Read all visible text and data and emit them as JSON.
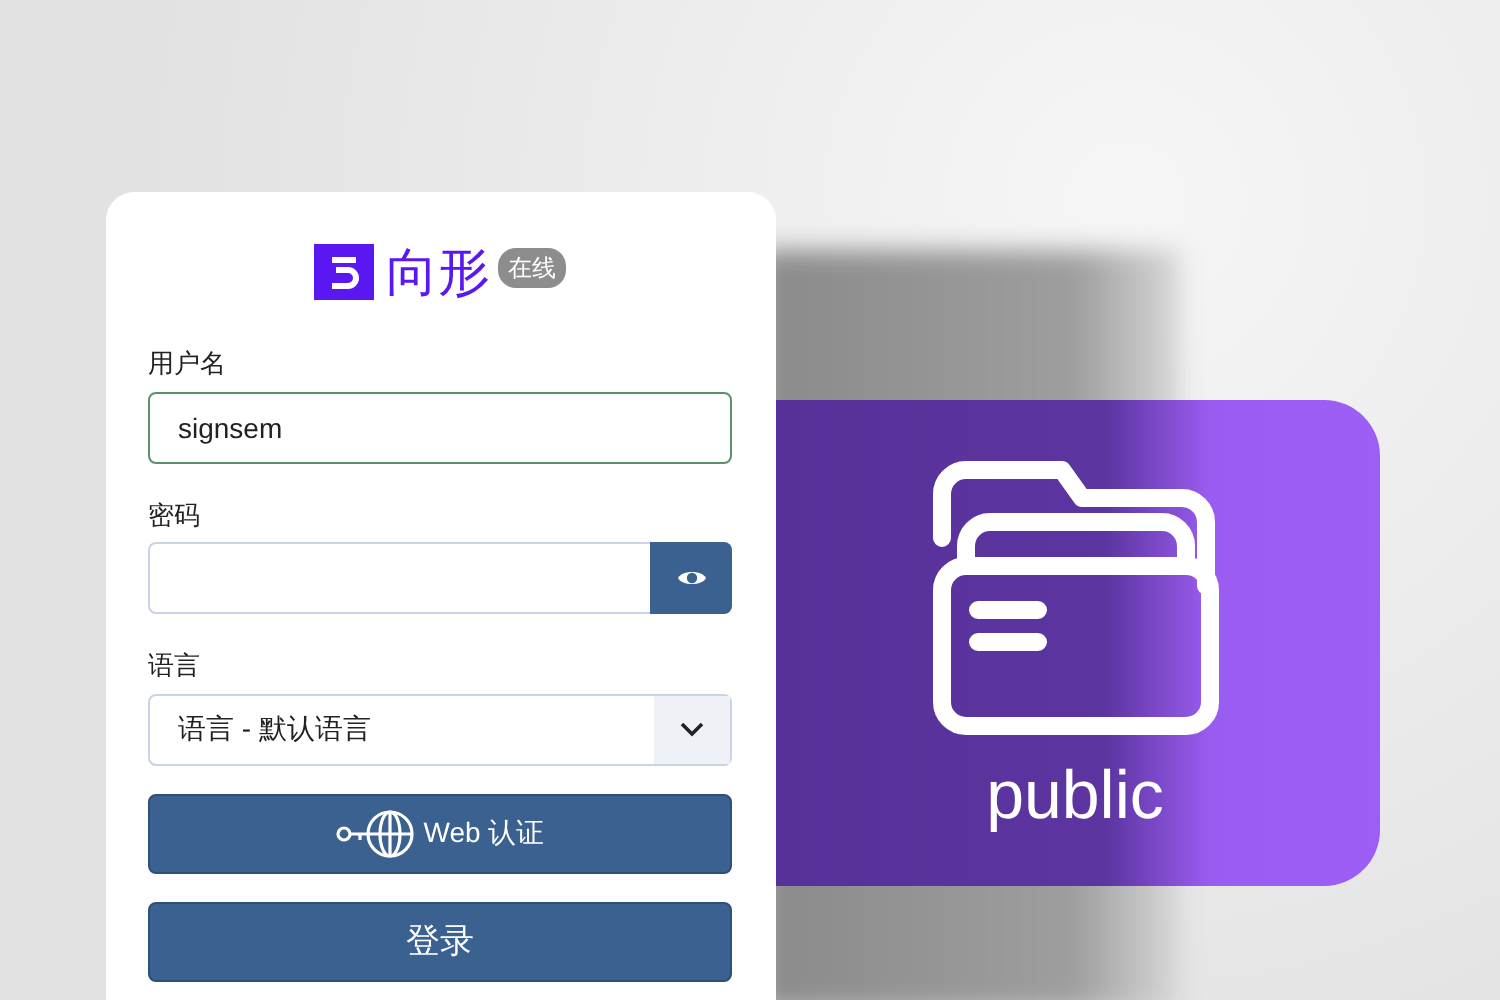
{
  "login": {
    "brand": "向形",
    "status_badge": "在线",
    "fields": [
      {
        "kind": "text",
        "label": "用户名",
        "value": "signsem",
        "valid": true
      },
      {
        "kind": "password",
        "label": "密码",
        "valid": false
      },
      {
        "kind": "select",
        "label": "语言",
        "value": "语言 - 默认语言",
        "valid": false
      }
    ],
    "buttons": [
      {
        "kind": "web-auth",
        "label": "Web 认证"
      },
      {
        "kind": "submit",
        "label": "登录"
      }
    ]
  },
  "folder_tile": {
    "label": "public"
  }
}
